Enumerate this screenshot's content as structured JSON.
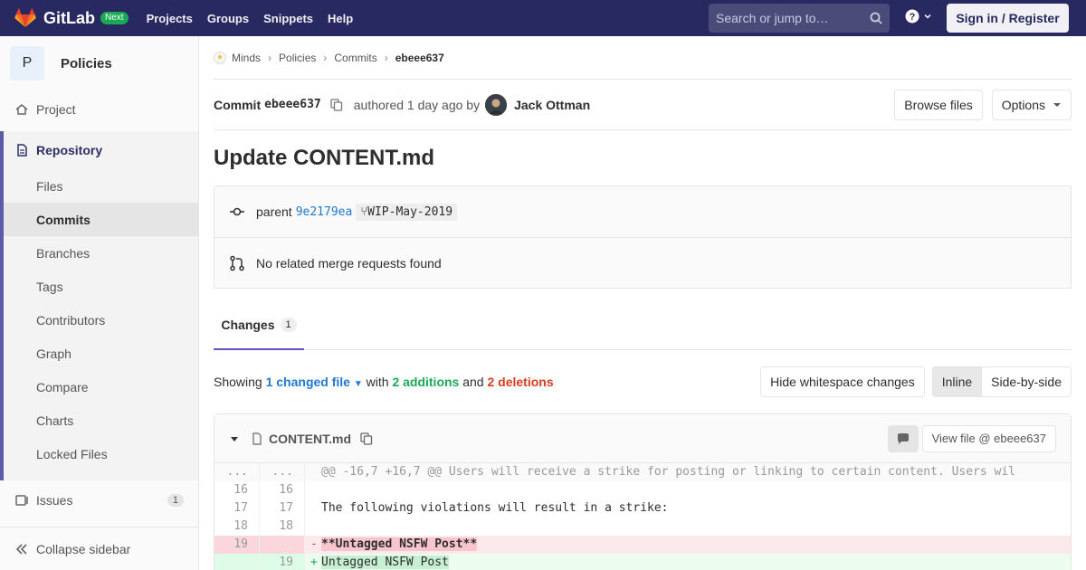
{
  "navbar": {
    "brand": "GitLab",
    "badge": "Next",
    "links": [
      "Projects",
      "Groups",
      "Snippets",
      "Help"
    ],
    "search_placeholder": "Search or jump to…",
    "signin": "Sign in / Register"
  },
  "sidebar": {
    "avatar_letter": "P",
    "project_name": "Policies",
    "project": "Project",
    "repository": "Repository",
    "repo_items": [
      "Files",
      "Commits",
      "Branches",
      "Tags",
      "Contributors",
      "Graph",
      "Compare",
      "Charts",
      "Locked Files"
    ],
    "issues": "Issues",
    "issues_count": "1",
    "collapse": "Collapse sidebar"
  },
  "breadcrumb": [
    "Minds",
    "Policies",
    "Commits",
    "ebeee637"
  ],
  "commit": {
    "label": "Commit",
    "sha": "ebeee637",
    "authored": "authored 1 day ago by",
    "author": "Jack Ottman",
    "browse": "Browse files",
    "options": "Options",
    "title": "Update CONTENT.md",
    "parent_label": "parent",
    "parent_sha": "9e2179ea",
    "branch": "WIP-May-2019",
    "merge_info": "No related merge requests found"
  },
  "changes": {
    "tab_label": "Changes",
    "tab_count": "1",
    "showing": "Showing",
    "changed_files": "1 changed file",
    "with": "with",
    "additions": "2 additions",
    "and": "and",
    "deletions": "2 deletions",
    "hide_ws": "Hide whitespace changes",
    "inline": "Inline",
    "side_by_side": "Side-by-side"
  },
  "file": {
    "name": "CONTENT.md",
    "view_file": "View file @ ebeee637",
    "lines": [
      {
        "type": "hunk",
        "old": "...",
        "new": "...",
        "sign": "",
        "text": "@@ -16,7 +16,7 @@ Users will receive a strike for posting or linking to certain content. Users wil"
      },
      {
        "type": "ctx",
        "old": "16",
        "new": "16",
        "sign": "",
        "text": ""
      },
      {
        "type": "ctx",
        "old": "17",
        "new": "17",
        "sign": "",
        "text": "The following violations will result in a strike:"
      },
      {
        "type": "ctx",
        "old": "18",
        "new": "18",
        "sign": "",
        "text": ""
      },
      {
        "type": "old",
        "old": "19",
        "new": "",
        "sign": "-",
        "text": "**Untagged NSFW Post**"
      },
      {
        "type": "new",
        "old": "",
        "new": "19",
        "sign": "+",
        "text": "Untagged NSFW Post"
      }
    ]
  }
}
